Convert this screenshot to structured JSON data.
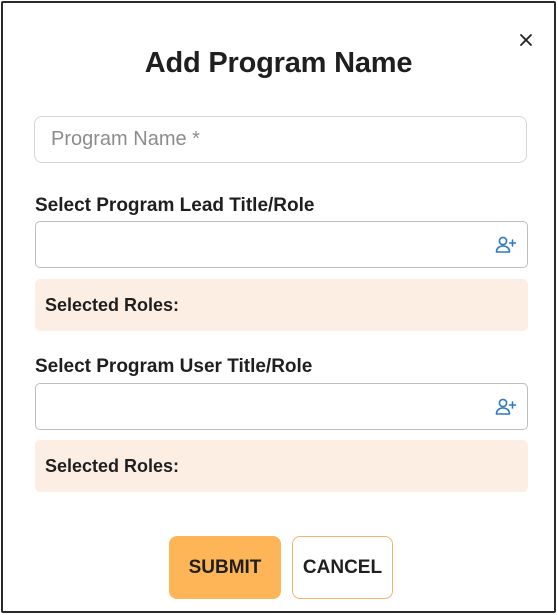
{
  "dialog": {
    "title": "Add Program Name",
    "close_glyph": "×"
  },
  "program_name": {
    "value": "",
    "placeholder": "Program Name *"
  },
  "lead": {
    "label": "Select Program Lead Title/Role",
    "add_icon": "person-add-icon",
    "selected_label": "Selected Roles:"
  },
  "user": {
    "label": "Select Program User Title/Role",
    "add_icon": "person-add-icon",
    "selected_label": "Selected Roles:"
  },
  "actions": {
    "submit_label": "SUBMIT",
    "cancel_label": "CANCEL"
  },
  "colors": {
    "accent": "#fdb558",
    "selected_bg": "#fdeee3",
    "icon": "#2f79c2"
  }
}
